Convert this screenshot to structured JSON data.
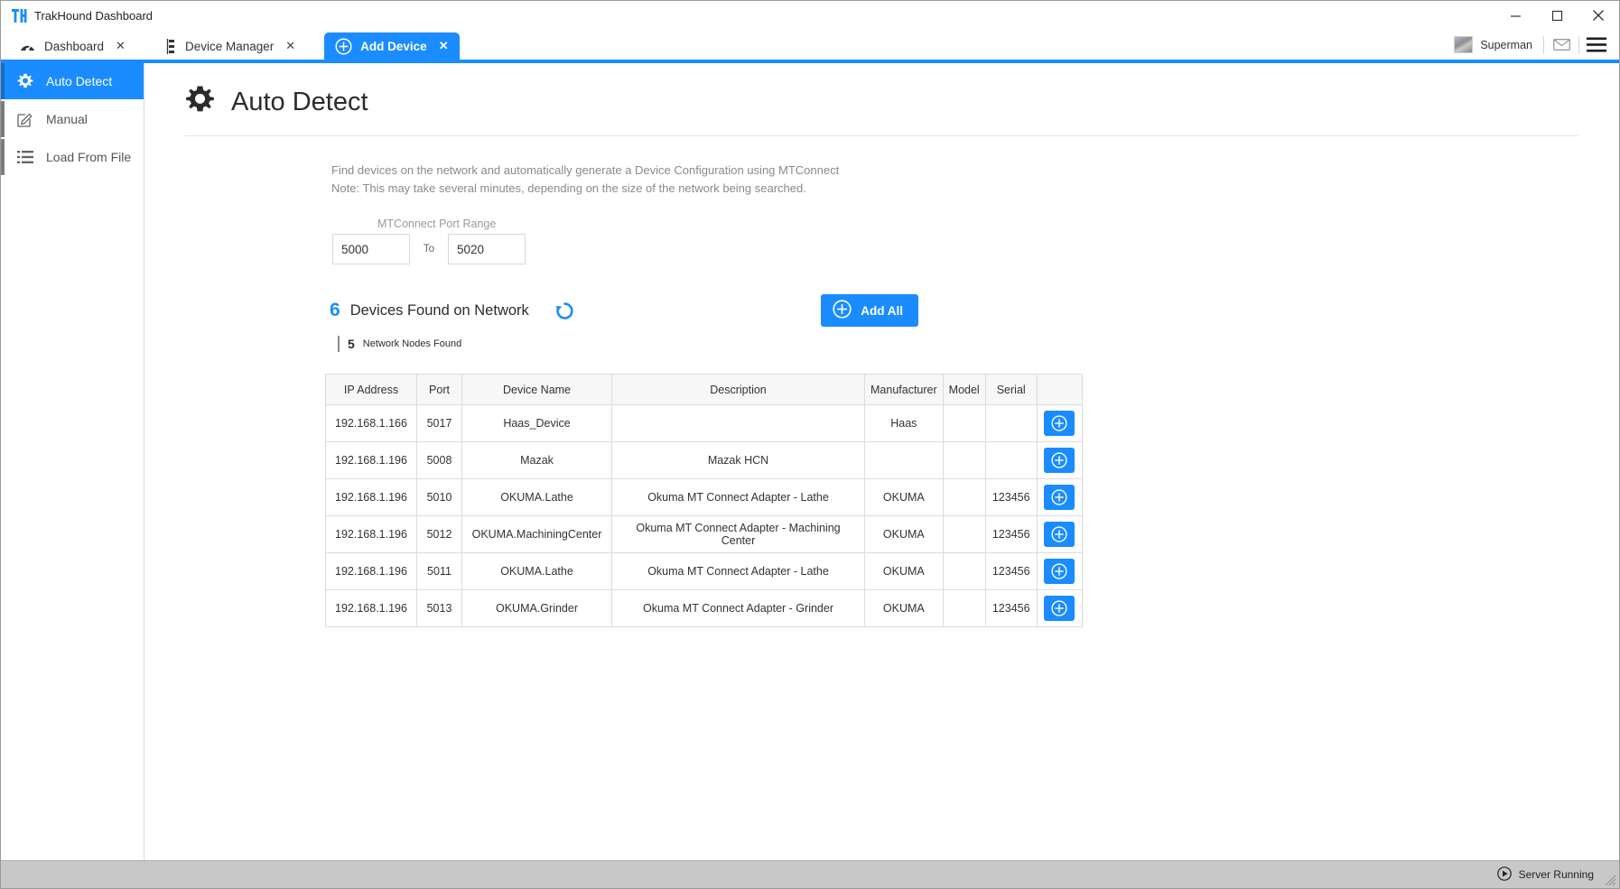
{
  "window": {
    "logo_text": "TH",
    "title": "TrakHound Dashboard",
    "minimize_label": "minimize",
    "maximize_label": "maximize",
    "close_label": "close"
  },
  "tabs": [
    {
      "label": "Dashboard",
      "icon": "dashboard-gauge-icon",
      "close": "✕",
      "active": false
    },
    {
      "label": "Device Manager",
      "icon": "device-manager-icon",
      "close": "✕",
      "active": false
    },
    {
      "label": "Add Device",
      "icon": "plus-circle-icon",
      "close": "✕",
      "active": true
    }
  ],
  "user": {
    "name": "Superman",
    "mail_icon": "mail-icon",
    "menu_icon": "hamburger-menu-icon"
  },
  "sidebar": {
    "items": [
      {
        "label": "Auto Detect",
        "icon": "gear-icon",
        "active": true
      },
      {
        "label": "Manual",
        "icon": "pencil-square-icon",
        "active": false
      },
      {
        "label": "Load From File",
        "icon": "list-icon",
        "active": false
      }
    ]
  },
  "page": {
    "title": "Auto Detect",
    "title_icon": "gear-icon",
    "description_line1": "Find devices on the network and automatically generate a Device Configuration using MTConnect",
    "description_line2": "Note: This may take several minutes, depending on the size of the network being searched."
  },
  "port_range": {
    "label": "MTConnect Port Range",
    "from_value": "5000",
    "to_label": "To",
    "to_value": "5020"
  },
  "results": {
    "device_count": "6",
    "device_count_text": "Devices Found on Network",
    "refresh_icon": "refresh-icon",
    "node_count": "5",
    "node_count_text": "Network Nodes Found",
    "add_all_label": "Add All",
    "add_all_icon": "plus-circle-icon"
  },
  "table": {
    "columns": [
      "IP Address",
      "Port",
      "Device Name",
      "Description",
      "Manufacturer",
      "Model",
      "Serial",
      ""
    ],
    "rows": [
      {
        "ip": "192.168.1.166",
        "port": "5017",
        "name": "Haas_Device",
        "description": "",
        "manufacturer": "Haas",
        "model": "",
        "serial": "",
        "action": "add-device-button"
      },
      {
        "ip": "192.168.1.196",
        "port": "5008",
        "name": "Mazak",
        "description": "Mazak HCN",
        "manufacturer": "",
        "model": "",
        "serial": "",
        "action": "add-device-button"
      },
      {
        "ip": "192.168.1.196",
        "port": "5010",
        "name": "OKUMA.Lathe",
        "description": "Okuma MT Connect Adapter - Lathe",
        "manufacturer": "OKUMA",
        "model": "",
        "serial": "123456",
        "action": "add-device-button"
      },
      {
        "ip": "192.168.1.196",
        "port": "5012",
        "name": "OKUMA.MachiningCenter",
        "description": "Okuma MT Connect Adapter - Machining Center",
        "manufacturer": "OKUMA",
        "model": "",
        "serial": "123456",
        "action": "add-device-button"
      },
      {
        "ip": "192.168.1.196",
        "port": "5011",
        "name": "OKUMA.Lathe",
        "description": "Okuma MT Connect Adapter - Lathe",
        "manufacturer": "OKUMA",
        "model": "",
        "serial": "123456",
        "action": "add-device-button"
      },
      {
        "ip": "192.168.1.196",
        "port": "5013",
        "name": "OKUMA.Grinder",
        "description": "Okuma MT Connect Adapter - Grinder",
        "manufacturer": "OKUMA",
        "model": "",
        "serial": "123456",
        "action": "add-device-button"
      }
    ]
  },
  "statusbar": {
    "server_status": "Server Running",
    "server_icon": "play-circle-icon"
  },
  "colors": {
    "accent": "#1a8cff",
    "statusbar_bg": "#c8c8c8",
    "muted_text": "#8a8a8a"
  }
}
